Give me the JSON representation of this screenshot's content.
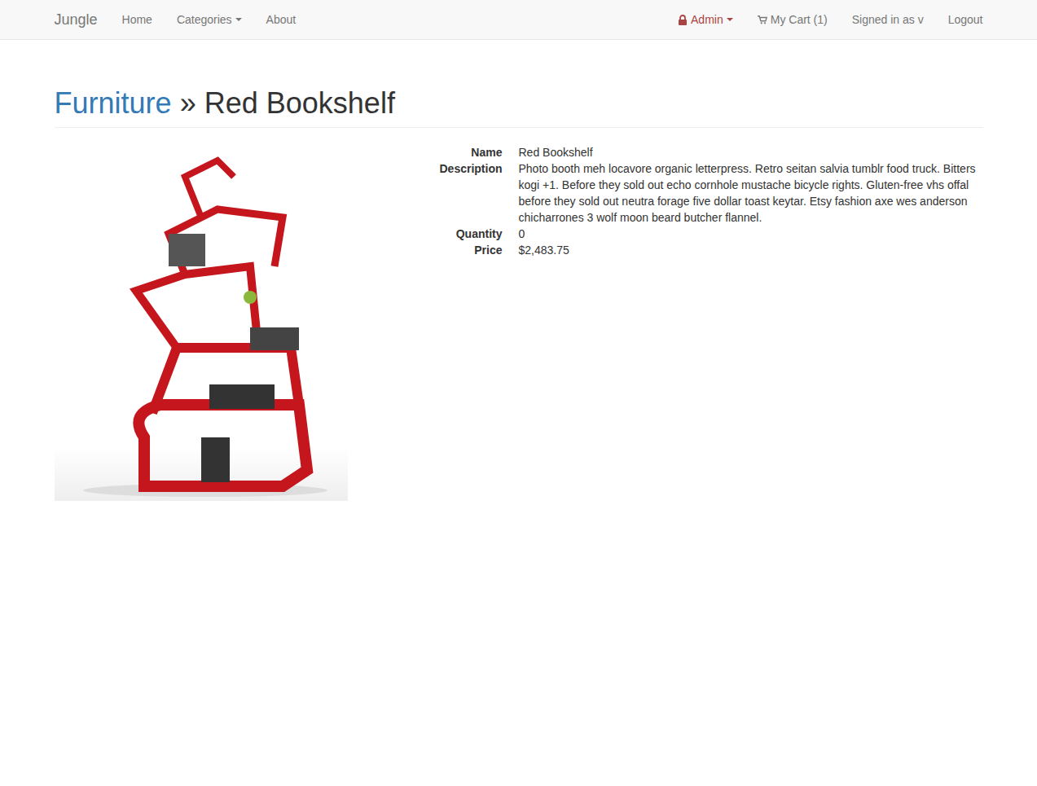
{
  "navbar": {
    "brand": "Jungle",
    "left": [
      {
        "label": "Home",
        "kind": "link"
      },
      {
        "label": "Categories",
        "kind": "dropdown"
      },
      {
        "label": "About",
        "kind": "link"
      }
    ],
    "right": [
      {
        "label": "Admin",
        "kind": "admin"
      },
      {
        "label": "My Cart (1)",
        "kind": "cart"
      },
      {
        "label": "Signed in as v",
        "kind": "text"
      },
      {
        "label": "Logout",
        "kind": "link"
      }
    ]
  },
  "header": {
    "category": "Furniture",
    "separator": "»",
    "title": "Red Bookshelf"
  },
  "product": {
    "fields": [
      {
        "label": "Name",
        "value": "Red Bookshelf"
      },
      {
        "label": "Description",
        "value": "Photo booth meh locavore organic letterpress. Retro seitan salvia tumblr food truck. Bitters kogi +1. Before they sold out echo cornhole mustache bicycle rights. Gluten-free vhs offal before they sold out neutra forage five dollar toast keytar. Etsy fashion axe wes anderson chicharrones 3 wolf moon beard butcher flannel."
      },
      {
        "label": "Quantity",
        "value": "0"
      },
      {
        "label": "Price",
        "value": "$2,483.75"
      }
    ]
  }
}
